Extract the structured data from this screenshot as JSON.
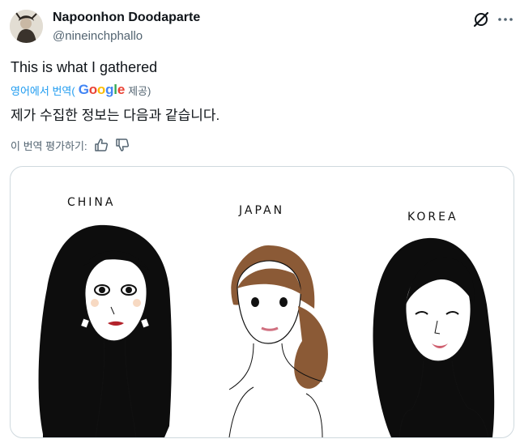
{
  "author": {
    "name": "Napoonhon Doodaparte",
    "handle": "@nineinchphallo"
  },
  "tweet": {
    "text": "This is what I gathered",
    "translation": {
      "translated_by": "영어에서 번역(",
      "provider": "Google",
      "provided": " 제공)",
      "text": "제가 수집한 정보는 다음과 같습니다.",
      "rate_label": "이 번역 평가하기:"
    }
  },
  "media": {
    "labels": [
      "CHINA",
      "JAPAN",
      "KOREA"
    ]
  },
  "icons": {
    "grok": "grok-icon",
    "more": "more-icon",
    "thumbs_up": "thumbs-up-icon",
    "thumbs_down": "thumbs-down-icon"
  },
  "colors": {
    "link": "#1d9bf0",
    "secondary_text": "#536471",
    "border": "#cfd9de"
  }
}
